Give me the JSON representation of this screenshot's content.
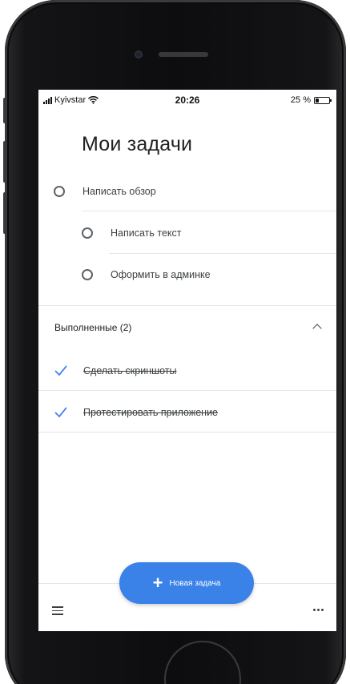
{
  "status_bar": {
    "carrier": "Kyivstar",
    "time": "20:26",
    "battery_percent": "25 %",
    "battery_level": 0.25
  },
  "page_title": "Мои задачи",
  "tasks": [
    {
      "label": "Написать обзор",
      "completed": false,
      "level": 0
    },
    {
      "label": "Написать текст",
      "completed": false,
      "level": 1
    },
    {
      "label": "Оформить в админке",
      "completed": false,
      "level": 1
    }
  ],
  "completed_section": {
    "header": "Выполненные (2)",
    "expanded": true,
    "items": [
      {
        "label": "Сделать скриншоты"
      },
      {
        "label": "Протестировать приложение"
      }
    ]
  },
  "fab": {
    "label": "Новая задача"
  },
  "icons": {
    "wifi": "wifi-icon",
    "battery": "battery-icon",
    "menu": "menu-icon",
    "more": "more-icon",
    "chevron": "chevron-up-icon",
    "check": "check-icon",
    "circle": "circle-icon",
    "plus": "plus-icon"
  },
  "colors": {
    "accent": "#3b82e8",
    "check": "#4285f4",
    "text": "#3c4043"
  }
}
